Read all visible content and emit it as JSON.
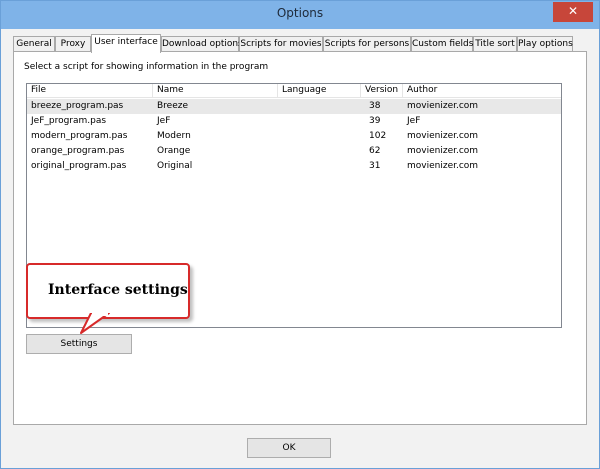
{
  "window": {
    "title": "Options",
    "close_glyph": "✕"
  },
  "tabs": [
    {
      "label": "General"
    },
    {
      "label": "Proxy"
    },
    {
      "label": "User interface",
      "active": true
    },
    {
      "label": "Download options"
    },
    {
      "label": "Scripts for movies"
    },
    {
      "label": "Scripts for persons"
    },
    {
      "label": "Custom fields"
    },
    {
      "label": "Title sort"
    },
    {
      "label": "Play options"
    }
  ],
  "panel": {
    "caption": "Select a script for showing information in the program",
    "columns": [
      "File",
      "Name",
      "Language",
      "Version",
      "Author"
    ],
    "rows": [
      {
        "file": "breeze_program.pas",
        "name": "Breeze",
        "language": "",
        "version": "38",
        "author": "movienizer.com",
        "selected": true
      },
      {
        "file": "JeF_program.pas",
        "name": "JeF",
        "language": "",
        "version": "39",
        "author": "JeF"
      },
      {
        "file": "modern_program.pas",
        "name": "Modern",
        "language": "",
        "version": "102",
        "author": "movienizer.com"
      },
      {
        "file": "orange_program.pas",
        "name": "Orange",
        "language": "",
        "version": "62",
        "author": "movienizer.com"
      },
      {
        "file": "original_program.pas",
        "name": "Original",
        "language": "",
        "version": "31",
        "author": "movienizer.com"
      }
    ],
    "settings_button": "Settings"
  },
  "callout": {
    "text": "Interface settings",
    "border_color": "#d72a2a"
  },
  "footer": {
    "ok_button": "OK"
  }
}
